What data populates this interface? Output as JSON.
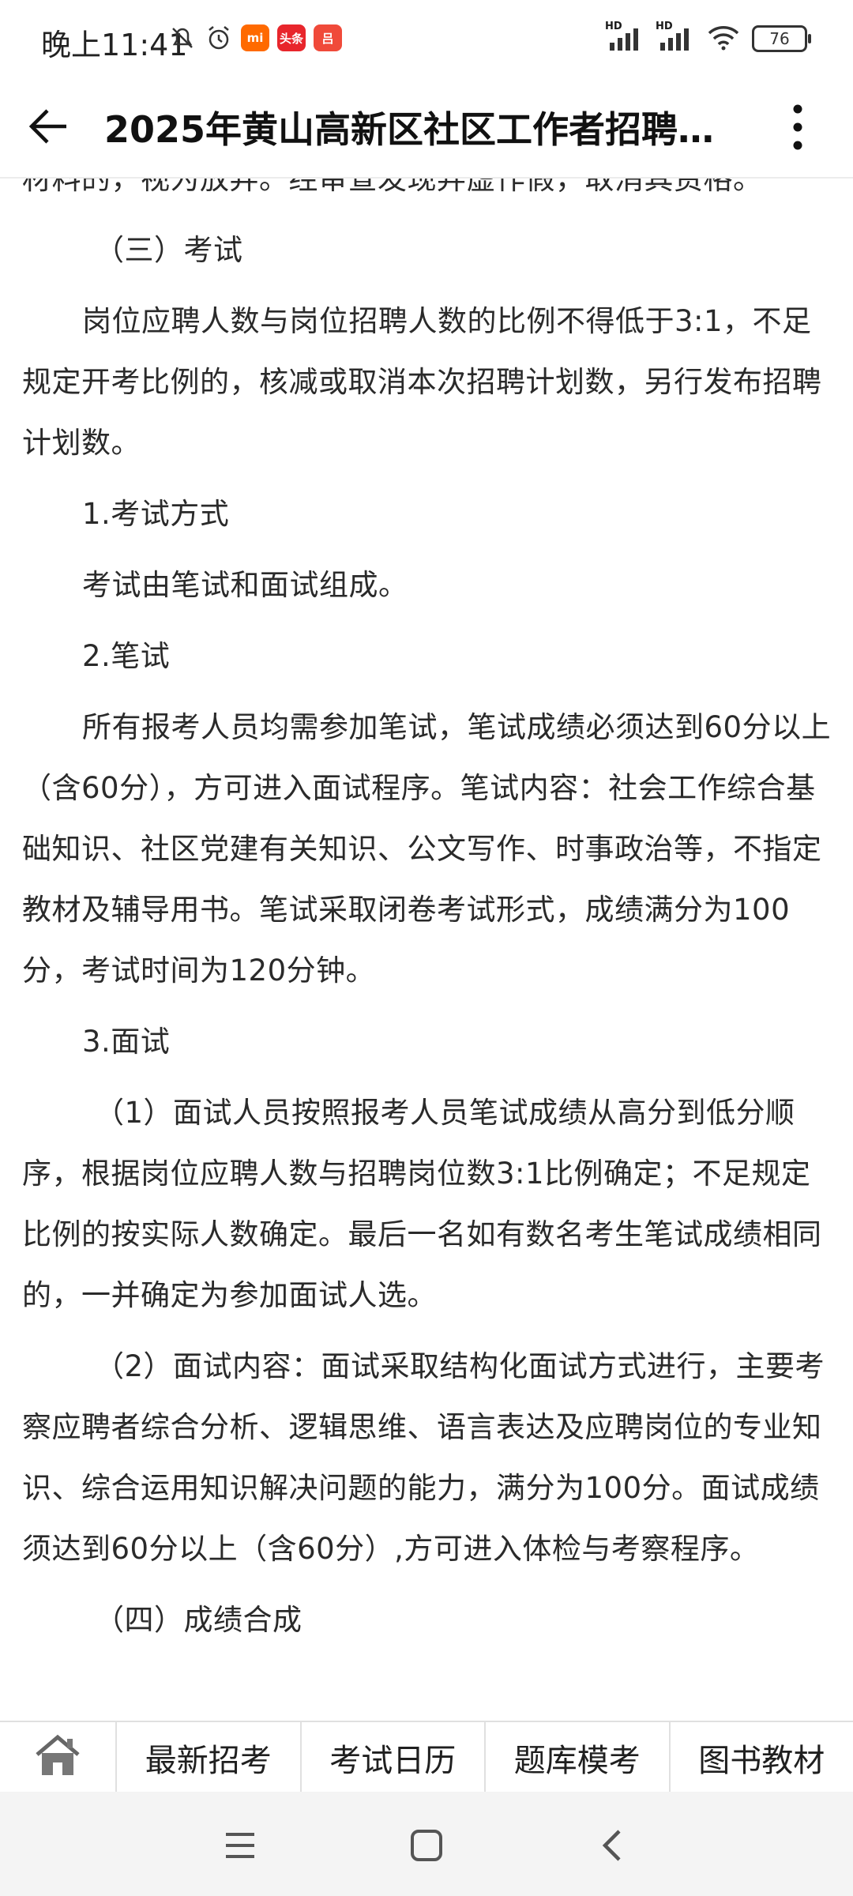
{
  "status_bar": {
    "time": "晚上11:41",
    "battery": "76",
    "network1": "HD",
    "network2": "HD",
    "app_badges": [
      {
        "name": "mi",
        "label": "mi",
        "color": "#ff6a00"
      },
      {
        "name": "toutiao",
        "label": "头条",
        "color": "#e8262c"
      },
      {
        "name": "app3",
        "label": "吕",
        "color": "#f04a3a"
      }
    ]
  },
  "app_bar": {
    "title": "2025年黄山高新区社区工作者招聘…"
  },
  "article": {
    "paragraphs": [
      {
        "text": "材料的，视为放弃。经审查发现弄虚作假，取消其资格。",
        "style": "plain"
      },
      {
        "text": "（三）考试",
        "style": "indent2"
      },
      {
        "text": "岗位应聘人数与岗位招聘人数的比例不得低于3:1，不足规定开考比例的，核减或取消本次招聘计划数，另行发布招聘计划数。",
        "style": "indent"
      },
      {
        "text": "1.考试方式",
        "style": "indent"
      },
      {
        "text": "考试由笔试和面试组成。",
        "style": "indent"
      },
      {
        "text": "2.笔试",
        "style": "indent"
      },
      {
        "text": "所有报考人员均需参加笔试，笔试成绩必须达到60分以上（含60分），方可进入面试程序。笔试内容：社会工作综合基础知识、社区党建有关知识、公文写作、时事政治等，不指定教材及辅导用书。笔试采取闭卷考试形式，成绩满分为100分，考试时间为120分钟。",
        "style": "indent"
      },
      {
        "text": "3.面试",
        "style": "indent"
      },
      {
        "text": "（1）面试人员按照报考人员笔试成绩从高分到低分顺序，根据岗位应聘人数与招聘岗位数3:1比例确定；不足规定比例的按实际人数确定。最后一名如有数名考生笔试成绩相同的，一并确定为参加面试人选。",
        "style": "indent2"
      },
      {
        "text": "（2）面试内容：面试采取结构化面试方式进行，主要考察应聘者综合分析、逻辑思维、语言表达及应聘岗位的专业知识、综合运用知识解决问题的能力，满分为100分。面试成绩须达到60分以上（含60分）,方可进入体检与考察程序。",
        "style": "indent2"
      },
      {
        "text": "（四）成绩合成",
        "style": "indent2"
      }
    ]
  },
  "bottom_nav": {
    "home_icon": "home-icon",
    "items": [
      {
        "label": "最新招考"
      },
      {
        "label": "考试日历"
      },
      {
        "label": "题库模考"
      },
      {
        "label": "图书教材"
      }
    ]
  },
  "system_nav": {
    "icons": [
      "menu-icon",
      "home-square-icon",
      "back-chevron-icon"
    ]
  }
}
